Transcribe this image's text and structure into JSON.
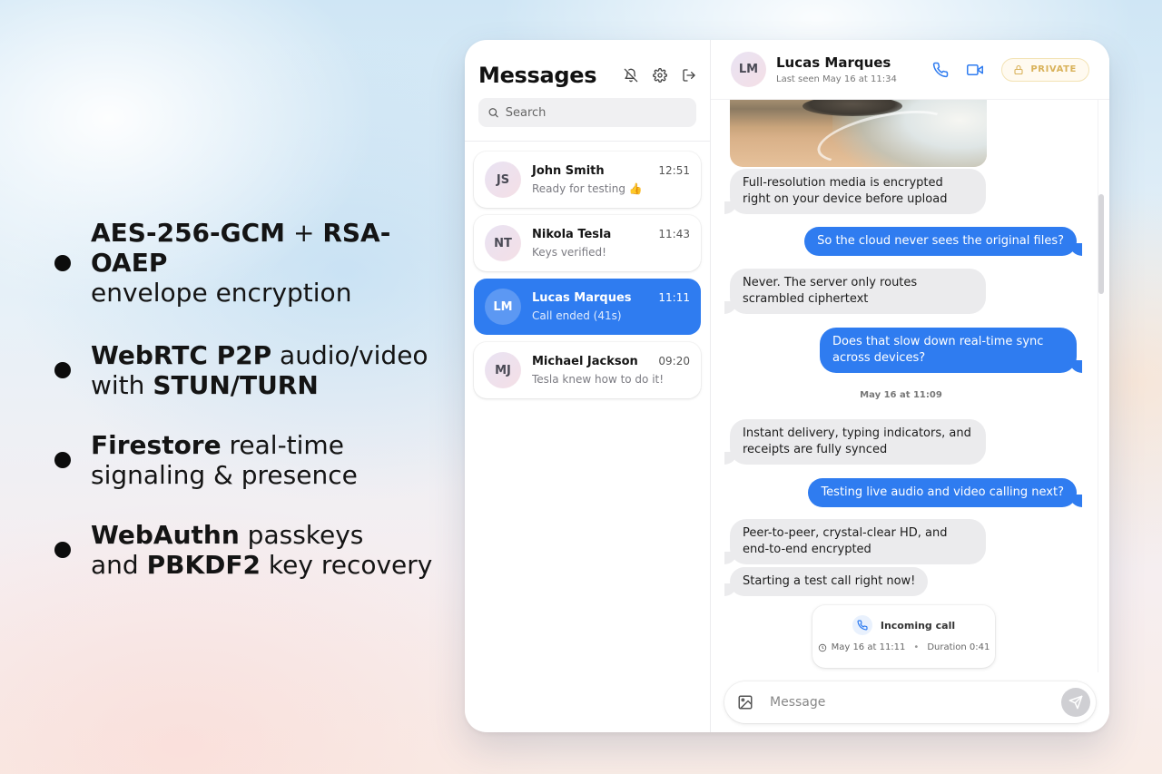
{
  "features": [
    {
      "bold": "AES-256-GCM",
      "plain": " + ",
      "bold2": "RSA-OAEP",
      "line2": "envelope encryption"
    },
    {
      "bold": "WebRTC P2P",
      "plain": " audio/video",
      "line2a": "with ",
      "line2b": "STUN/TURN"
    },
    {
      "bold": "Firestore",
      "plain": " real-time",
      "line2": "signaling & presence"
    },
    {
      "bold": "WebAuthn",
      "plain": " passkeys",
      "line2a": "and ",
      "line2b": "PBKDF2",
      "line2c": " key recovery"
    }
  ],
  "sidebar": {
    "title": "Messages",
    "icons": [
      "bell-off-icon",
      "gear-icon",
      "logout-icon"
    ],
    "search_placeholder": "Search",
    "chats": [
      {
        "initials": "JS",
        "name": "John Smith",
        "time": "12:51",
        "preview": "Ready for testing 👍",
        "active": false
      },
      {
        "initials": "NT",
        "name": "Nikola Tesla",
        "time": "11:43",
        "preview": "Keys verified!",
        "active": false
      },
      {
        "initials": "LM",
        "name": "Lucas Marques",
        "time": "11:11",
        "preview": "Call ended (41s)",
        "active": true
      },
      {
        "initials": "MJ",
        "name": "Michael Jackson",
        "time": "09:20",
        "preview": "Tesla knew how to do it!",
        "active": false
      }
    ]
  },
  "conversation": {
    "avatar_initials": "LM",
    "contact_name": "Lucas Marques",
    "last_seen": "Last seen May 16 at 11:34",
    "private_label": "PRIVATE",
    "messages": [
      {
        "dir": "in",
        "text": "Full-resolution media is encrypted right on your device before upload"
      },
      {
        "dir": "out",
        "text": "So the cloud never sees the original files?"
      },
      {
        "dir": "in",
        "text": "Never. The server only routes scrambled ciphertext"
      },
      {
        "dir": "out",
        "text": "Does that slow down real-time sync across devices?"
      },
      {
        "dir": "in",
        "text": "Instant delivery, typing indicators, and receipts are fully synced"
      },
      {
        "dir": "out",
        "text": "Testing live audio and video calling next?"
      },
      {
        "dir": "in",
        "text": "Peer-to-peer, crystal-clear HD, and end-to-end encrypted"
      },
      {
        "dir": "in",
        "text": "Starting a test call right now!"
      }
    ],
    "date_separator": "May 16 at 11:09",
    "call_card": {
      "title": "Incoming call",
      "time": "May 16 at 11:11",
      "duration": "Duration 0:41"
    },
    "composer_placeholder": "Message"
  },
  "colors": {
    "accent": "#2f7cf0",
    "incoming_bubble": "#ebebed",
    "private_badge": "#d9b25a"
  }
}
